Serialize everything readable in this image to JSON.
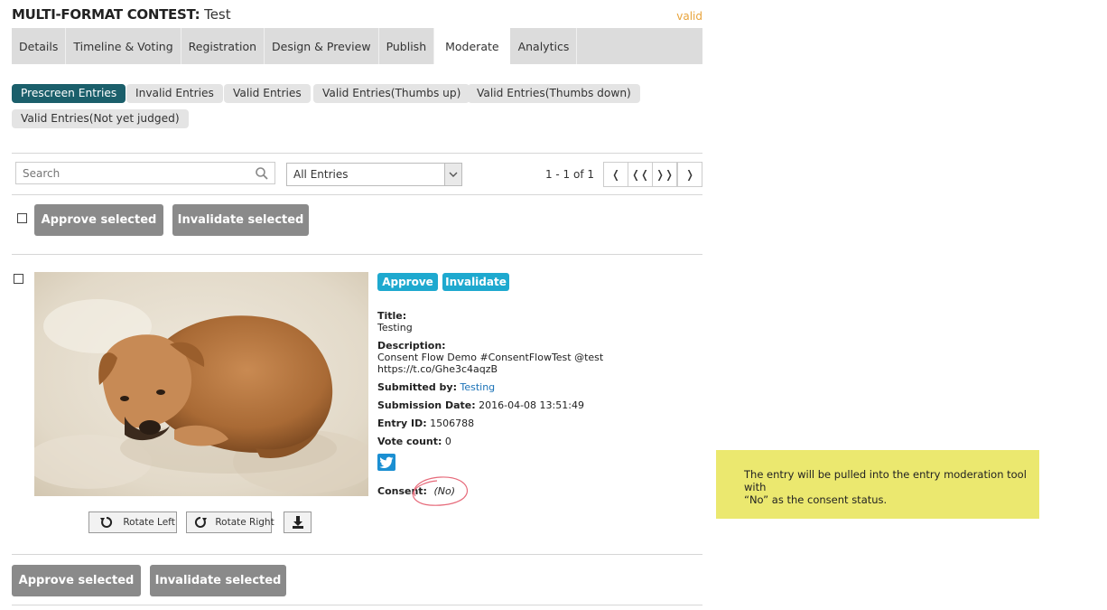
{
  "header": {
    "label": "MULTI-FORMAT CONTEST:",
    "name": "Test",
    "status": "valid"
  },
  "tabs": [
    {
      "label": "Details"
    },
    {
      "label": "Timeline & Voting"
    },
    {
      "label": "Registration"
    },
    {
      "label": "Design & Preview"
    },
    {
      "label": "Publish"
    },
    {
      "label": "Moderate"
    },
    {
      "label": "Analytics"
    }
  ],
  "filters": [
    {
      "label": "Prescreen Entries"
    },
    {
      "label": "Invalid Entries"
    },
    {
      "label": "Valid Entries"
    },
    {
      "label": "Valid Entries(Thumbs up)"
    },
    {
      "label": "Valid Entries(Thumbs down)"
    },
    {
      "label": "Valid Entries(Not yet judged)"
    }
  ],
  "toolbar": {
    "search_placeholder": "Search",
    "select_value": "All Entries",
    "pager_text": "1 - 1 of 1",
    "pager_prev": "❬",
    "pager_first": "❬❬",
    "pager_last": "❭❭",
    "pager_next": "❭"
  },
  "bulk": {
    "approve_label": "Approve selected",
    "invalidate_label": "Invalidate selected"
  },
  "entry": {
    "approve_label": "Approve",
    "invalidate_label": "Invalidate",
    "title_label": "Title:",
    "title": "Testing",
    "description_label": "Description:",
    "description_line1": "Consent Flow Demo #ConsentFlowTest @test",
    "description_line2": "https://t.co/Ghe3c4aqzB",
    "submitted_by_label": "Submitted by:",
    "submitted_by": "Testing",
    "submission_date_label": "Submission Date:",
    "submission_date": "2016-04-08 13:51:49",
    "entry_id_label": "Entry ID:",
    "entry_id": "1506788",
    "vote_count_label": "Vote count:",
    "vote_count": "0",
    "consent_label": "Consent:",
    "consent_value": "(No)",
    "rotate_left_label": "Rotate Left",
    "rotate_right_label": "Rotate Right"
  },
  "note": {
    "line1": "The entry will be pulled into the entry moderation tool with",
    "line2": "“No” as the consent status."
  },
  "colors": {
    "active_filter": "#1b5f6b",
    "action_blue": "#1ea9cf",
    "status_orange": "#e8a33a",
    "note_bg": "#ebe86f"
  }
}
